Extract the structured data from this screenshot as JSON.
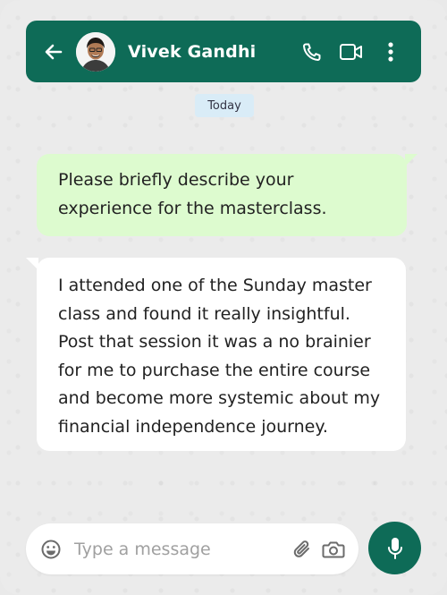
{
  "header": {
    "contact_name": "Vivek Gandhi",
    "back_icon": "arrow-left-icon",
    "call_icon": "phone-icon",
    "video_icon": "video-camera-icon",
    "menu_icon": "more-vertical-icon"
  },
  "chat": {
    "date_label": "Today",
    "messages": [
      {
        "direction": "outgoing",
        "text": "Please briefly describe your experience for the masterclass."
      },
      {
        "direction": "incoming",
        "text": "I attended one of the Sunday master class and found it really insightful. Post that session it was a no brainier for me to purchase the entire course and become more systemic about my financial independence journey."
      }
    ]
  },
  "composer": {
    "placeholder": "Type a message",
    "emoji_icon": "emoji-icon",
    "attach_icon": "paperclip-icon",
    "camera_icon": "camera-icon",
    "mic_icon": "microphone-icon"
  },
  "colors": {
    "brand": "#0e6b57",
    "outgoing_bubble": "#ddfbcf",
    "incoming_bubble": "#ffffff",
    "date_badge": "#d9ecf7",
    "background": "#ebebeb"
  }
}
